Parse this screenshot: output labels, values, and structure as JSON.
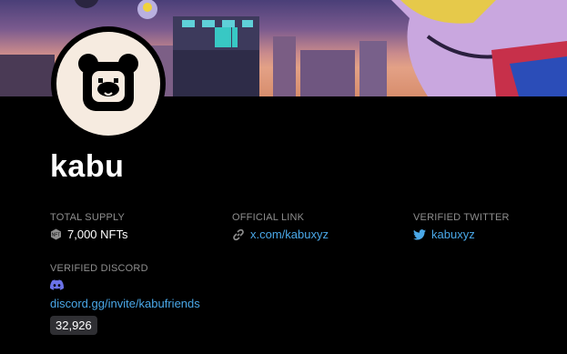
{
  "collection": {
    "name": "kabu"
  },
  "stats": {
    "total_supply": {
      "label": "TOTAL SUPPLY",
      "value": "7,000 NFTs",
      "icon": "nft-icon"
    },
    "official_link": {
      "label": "OFFICIAL LINK",
      "value": "x.com/kabuxyz",
      "icon": "link-icon"
    },
    "verified_twitter": {
      "label": "VERIFIED TWITTER",
      "value": "kabuxyz",
      "icon": "twitter-icon"
    },
    "verified_discord": {
      "label": "VERIFIED DISCORD",
      "value": "discord.gg/invite/kabufriends",
      "members": "32,926",
      "icon": "discord-icon"
    }
  },
  "colors": {
    "link": "#4aa8e8",
    "discord": "#6b72e8",
    "badge_bg": "#2f2f33"
  }
}
